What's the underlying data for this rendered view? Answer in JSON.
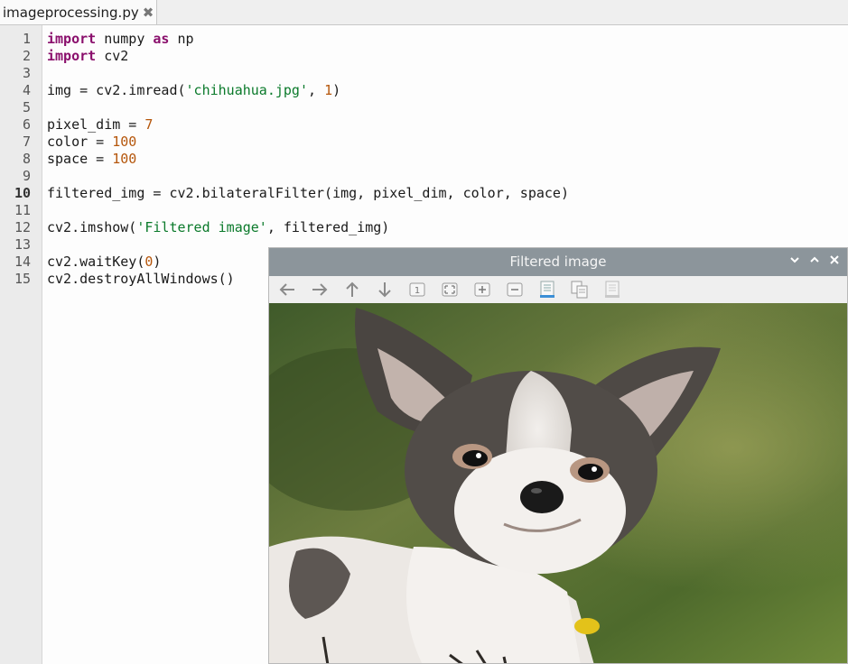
{
  "tab": {
    "label": "imageprocessing.py",
    "close_glyph": "✖"
  },
  "editor": {
    "current_line": 10,
    "lines": [
      {
        "n": "1",
        "parts": [
          [
            "kw",
            "import"
          ],
          [
            "",
            " numpy "
          ],
          [
            "kw",
            "as"
          ],
          [
            "",
            " np"
          ]
        ]
      },
      {
        "n": "2",
        "parts": [
          [
            "kw",
            "import"
          ],
          [
            "",
            " cv2"
          ]
        ]
      },
      {
        "n": "3",
        "parts": []
      },
      {
        "n": "4",
        "parts": [
          [
            "",
            "img = cv2.imread("
          ],
          [
            "str",
            "'chihuahua.jpg'"
          ],
          [
            "",
            ", "
          ],
          [
            "num",
            "1"
          ],
          [
            "",
            ")"
          ]
        ]
      },
      {
        "n": "5",
        "parts": []
      },
      {
        "n": "6",
        "parts": [
          [
            "",
            "pixel_dim = "
          ],
          [
            "num",
            "7"
          ]
        ]
      },
      {
        "n": "7",
        "parts": [
          [
            "",
            "color = "
          ],
          [
            "num",
            "100"
          ]
        ]
      },
      {
        "n": "8",
        "parts": [
          [
            "",
            "space = "
          ],
          [
            "num",
            "100"
          ]
        ]
      },
      {
        "n": "9",
        "parts": []
      },
      {
        "n": "10",
        "parts": [
          [
            "",
            "filtered_img = cv2.bilateralFilter(img, pixel_dim, color, space)"
          ]
        ]
      },
      {
        "n": "11",
        "parts": []
      },
      {
        "n": "12",
        "parts": [
          [
            "",
            "cv2.imshow("
          ],
          [
            "str",
            "'Filtered image'"
          ],
          [
            "",
            ", filtered_img)"
          ]
        ]
      },
      {
        "n": "13",
        "parts": []
      },
      {
        "n": "14",
        "parts": [
          [
            "",
            "cv2.waitKey("
          ],
          [
            "num",
            "0"
          ],
          [
            "",
            ")"
          ]
        ]
      },
      {
        "n": "15",
        "parts": [
          [
            "",
            "cv2.destroyAllWindows()"
          ]
        ]
      }
    ]
  },
  "window": {
    "title": "Filtered image",
    "controls": [
      "chevron-down-icon",
      "chevron-up-icon",
      "close-icon"
    ],
    "toolbar": [
      {
        "name": "arrow-left-icon",
        "glyph": "←"
      },
      {
        "name": "arrow-right-icon",
        "glyph": "→"
      },
      {
        "name": "arrow-up-icon",
        "glyph": "↑"
      },
      {
        "name": "arrow-down-icon",
        "glyph": "↓"
      },
      {
        "name": "zoom-reset-icon",
        "glyph": "1"
      },
      {
        "name": "zoom-fit-icon",
        "glyph": "⛶"
      },
      {
        "name": "zoom-in-icon",
        "glyph": "+"
      },
      {
        "name": "zoom-out-icon",
        "glyph": "−"
      },
      {
        "name": "save-image-icon",
        "glyph": ""
      },
      {
        "name": "copy-image-icon",
        "glyph": ""
      },
      {
        "name": "properties-icon",
        "glyph": ""
      }
    ]
  },
  "colors": {
    "keyword": "#8a0f6c",
    "string": "#0b7a2b",
    "number": "#b5560b",
    "titlebar": "#8c959b"
  }
}
